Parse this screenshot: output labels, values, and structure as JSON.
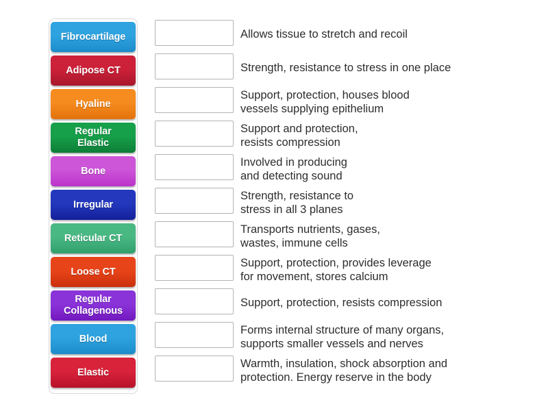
{
  "activity": {
    "type": "match-up",
    "tile_bank": {
      "name": "answer-tiles",
      "tiles": [
        {
          "label": "Fibrocartilage",
          "color": "#2ea3e0",
          "color_dark": "#1b8cc9"
        },
        {
          "label": "Adipose CT",
          "color": "#cc2139",
          "color_dark": "#a8172b"
        },
        {
          "label": "Hyaline",
          "color": "#f68b1f",
          "color_dark": "#e2730c"
        },
        {
          "label": "Regular\nElastic",
          "color": "#17a04a",
          "color_dark": "#0d7d37"
        },
        {
          "label": "Bone",
          "color": "#cc55d8",
          "color_dark": "#bb33c9"
        },
        {
          "label": "Irregular",
          "color": "#2338bd",
          "color_dark": "#14209b"
        },
        {
          "label": "Reticular CT",
          "color": "#49b883",
          "color_dark": "#31a06c"
        },
        {
          "label": "Loose CT",
          "color": "#e8441a",
          "color_dark": "#cb300b"
        },
        {
          "label": "Regular\nCollagenous",
          "color": "#8a33d8",
          "color_dark": "#7318c0"
        },
        {
          "label": "Blood",
          "color": "#2ea3e0",
          "color_dark": "#1b8cc9"
        },
        {
          "label": "Elastic",
          "color": "#d8233a",
          "color_dark": "#b8122a"
        }
      ]
    },
    "answers": [
      {
        "text": "Allows tissue to stretch and recoil",
        "lines": 1
      },
      {
        "text": "Strength, resistance to stress in one place",
        "lines": 1
      },
      {
        "text": "Support, protection, houses blood\nvessels supplying epithelium",
        "lines": 2
      },
      {
        "text": "Support and protection,\nresists compression",
        "lines": 2
      },
      {
        "text": "Involved in producing\nand detecting sound",
        "lines": 2
      },
      {
        "text": "Strength, resistance to\nstress in all 3 planes",
        "lines": 2
      },
      {
        "text": "Transports nutrients, gases,\nwastes, immune cells",
        "lines": 2
      },
      {
        "text": "Support, protection, provides leverage\nfor movement, stores calcium",
        "lines": 2
      },
      {
        "text": "Support, protection, resists compression",
        "lines": 1
      },
      {
        "text": "Forms internal structure of many organs,\nsupports smaller vessels and nerves",
        "lines": 2
      },
      {
        "text": "Warmth, insulation, shock absorption and\nprotection. Energy reserve in the body",
        "lines": 2
      }
    ]
  },
  "theme": {
    "background": "#ffffff",
    "text_color": "#2d2d2d",
    "box_border": "#b3b3b3",
    "bank_border": "#d8d8d8"
  }
}
